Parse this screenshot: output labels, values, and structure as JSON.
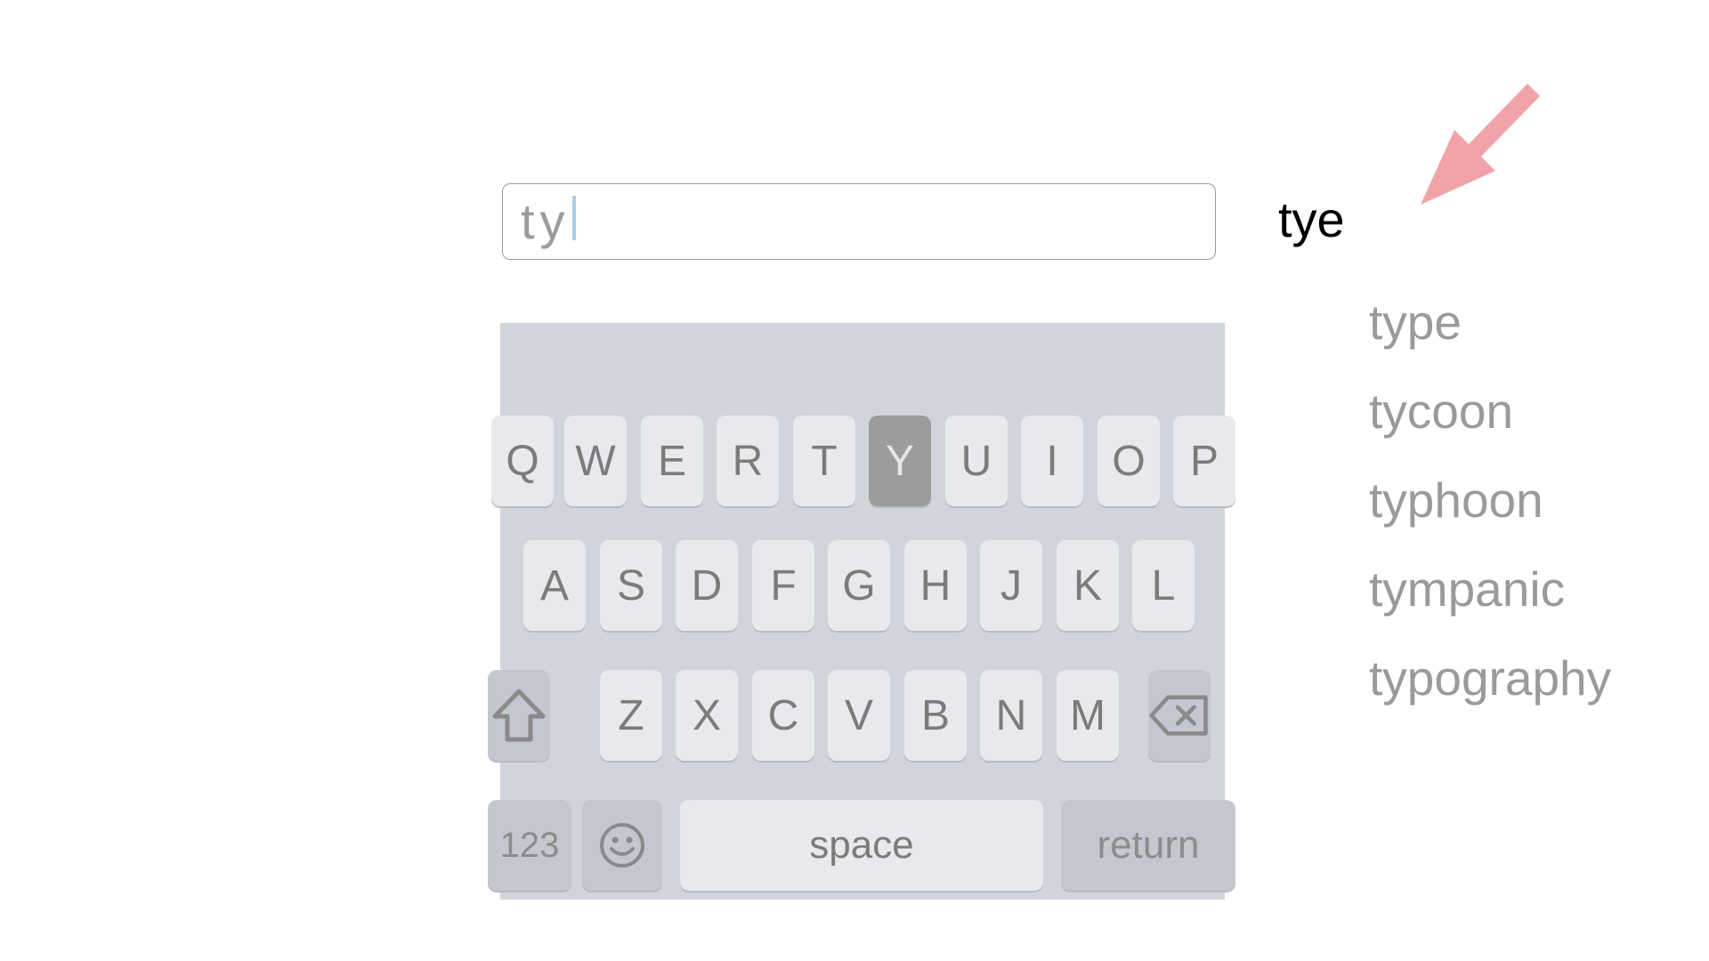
{
  "field": {
    "typed": "ty"
  },
  "typed_word": "tye",
  "suggestions": [
    "type",
    "tycoon",
    "typhoon",
    "tympanic",
    "typography"
  ],
  "keyboard": {
    "row1": [
      "Q",
      "W",
      "E",
      "R",
      "T",
      "Y",
      "U",
      "I",
      "O",
      "P"
    ],
    "row2": [
      "A",
      "S",
      "D",
      "F",
      "G",
      "H",
      "J",
      "K",
      "L"
    ],
    "row3": [
      "Z",
      "X",
      "C",
      "V",
      "B",
      "N",
      "M"
    ],
    "pressed_key": "Y",
    "numbers_label": "123",
    "space_label": "space",
    "return_label": "return"
  },
  "colors": {
    "arrow": "#ee9aa0",
    "pressed_key": "#9c9c9f",
    "keyboard_bg": "#d1d4db"
  },
  "icons": {
    "shift": "shift-arrow-icon",
    "delete": "backspace-icon",
    "emoji": "smiley-face-icon",
    "pointer": "red-arrow-icon"
  }
}
